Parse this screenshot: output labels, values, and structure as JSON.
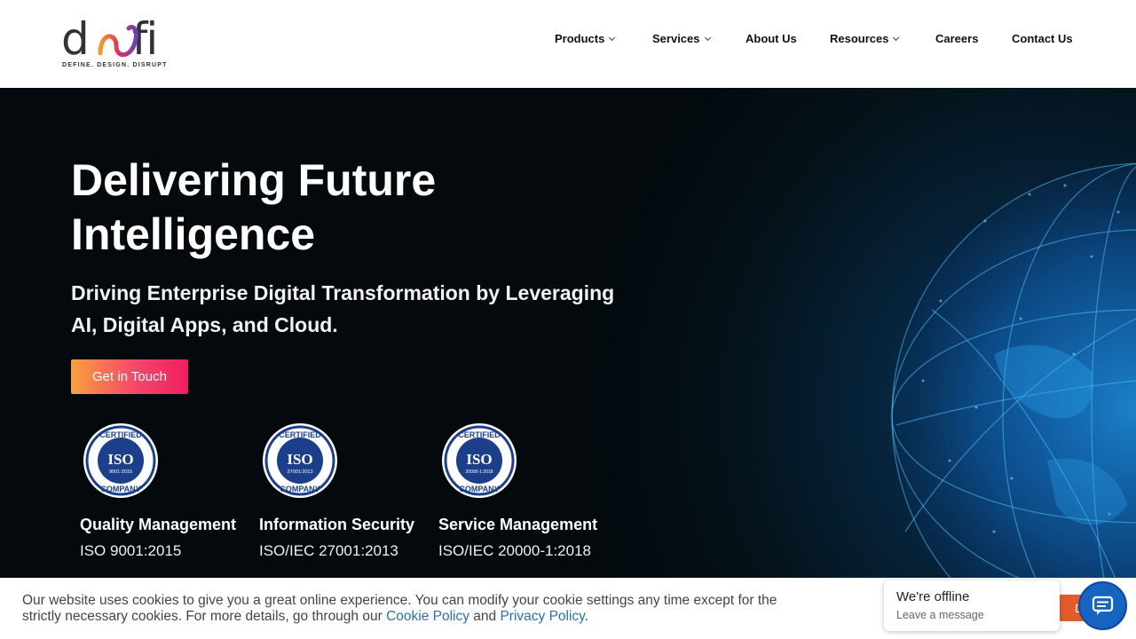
{
  "header": {
    "logo_word": "d",
    "logo_word_end": "fi",
    "logo_tagline": "DEFINE. DESIGN. DISRUPT",
    "nav": [
      {
        "label": "Products",
        "dropdown": true
      },
      {
        "label": "Services",
        "dropdown": true
      },
      {
        "label": "About Us",
        "dropdown": false
      },
      {
        "label": "Resources",
        "dropdown": true
      },
      {
        "label": "Careers",
        "dropdown": false
      },
      {
        "label": "Contact Us",
        "dropdown": false
      }
    ]
  },
  "hero": {
    "title_line1": "Delivering Future",
    "title_line2": "Intelligence",
    "subtitle_line1": "Driving Enterprise Digital Transformation by Leveraging",
    "subtitle_line2": "AI, Digital Apps, and Cloud.",
    "cta_label": "Get in Touch"
  },
  "certifications": [
    {
      "seal_top": "CERTIFIED",
      "seal_mid": "ISO",
      "seal_num": "9001:2015",
      "seal_bottom": "COMPANY",
      "title": "Quality Management",
      "standard": "ISO 9001:2015"
    },
    {
      "seal_top": "CERTIFIED",
      "seal_mid": "ISO",
      "seal_num": "27001:2013",
      "seal_bottom": "COMPANY",
      "title": "Information Security",
      "standard": "ISO/IEC 27001:2013"
    },
    {
      "seal_top": "CERTIFIED",
      "seal_mid": "ISO",
      "seal_num": "20000-1:2018",
      "seal_bottom": "COMPANY",
      "title": "Service Management",
      "standard": "ISO/IEC 20000-1:2018"
    }
  ],
  "cookie": {
    "text_part1": "Our website uses cookies to give you a great online experience. You can modify your cookie settings any time except for the strictly necessary cookies. For more details, go through our ",
    "cookie_policy_link": "Cookie Policy",
    "and": " and ",
    "privacy_policy_link": "Privacy Policy",
    "end": ".",
    "decline_label": "Decline"
  },
  "chat": {
    "status_title": "We're offline",
    "status_sub": "Leave a message",
    "icon": "chat-bubble-icon"
  },
  "colors": {
    "brand_gradient_start": "#f9a13c",
    "brand_gradient_end": "#ee1f5e",
    "link": "#2a6fb0",
    "chat_button": "#1565c0",
    "seal_blue": "#1b3f8b"
  }
}
